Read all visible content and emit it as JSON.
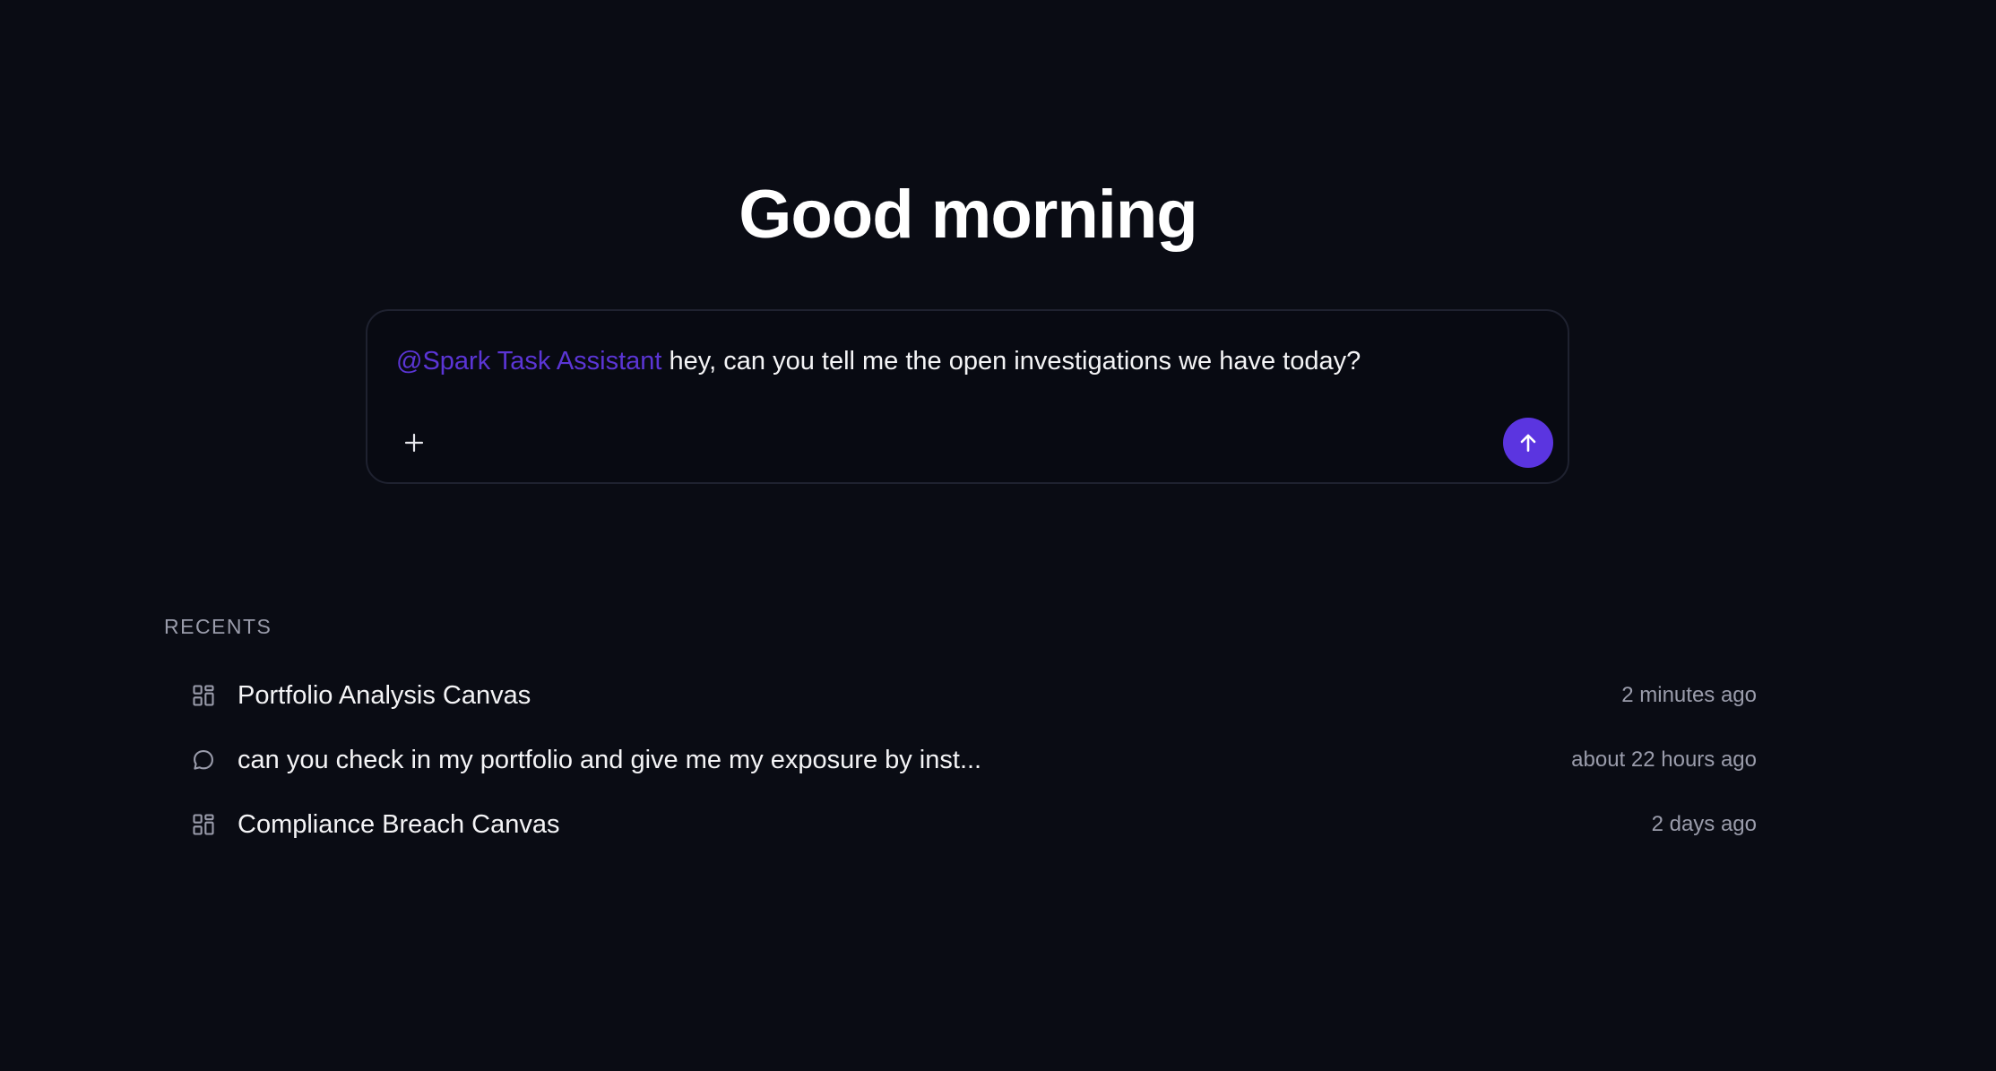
{
  "greeting": "Good morning",
  "composer": {
    "mention": "@Spark Task Assistant",
    "message": " hey, can you tell me the open investigations we have today?",
    "add_icon": "plus-icon",
    "send_icon": "arrow-up-icon",
    "mention_color": "#5b35d5",
    "send_color": "#5b35e0"
  },
  "recents": {
    "label": "RECENTS",
    "items": [
      {
        "icon": "canvas-icon",
        "title": "Portfolio Analysis Canvas",
        "time": "2 minutes ago"
      },
      {
        "icon": "chat-bubble-icon",
        "title": "can you check in my portfolio and give me my exposure by inst...",
        "time": "about 22 hours ago"
      },
      {
        "icon": "canvas-icon",
        "title": "Compliance Breach Canvas",
        "time": "2 days ago"
      }
    ]
  }
}
